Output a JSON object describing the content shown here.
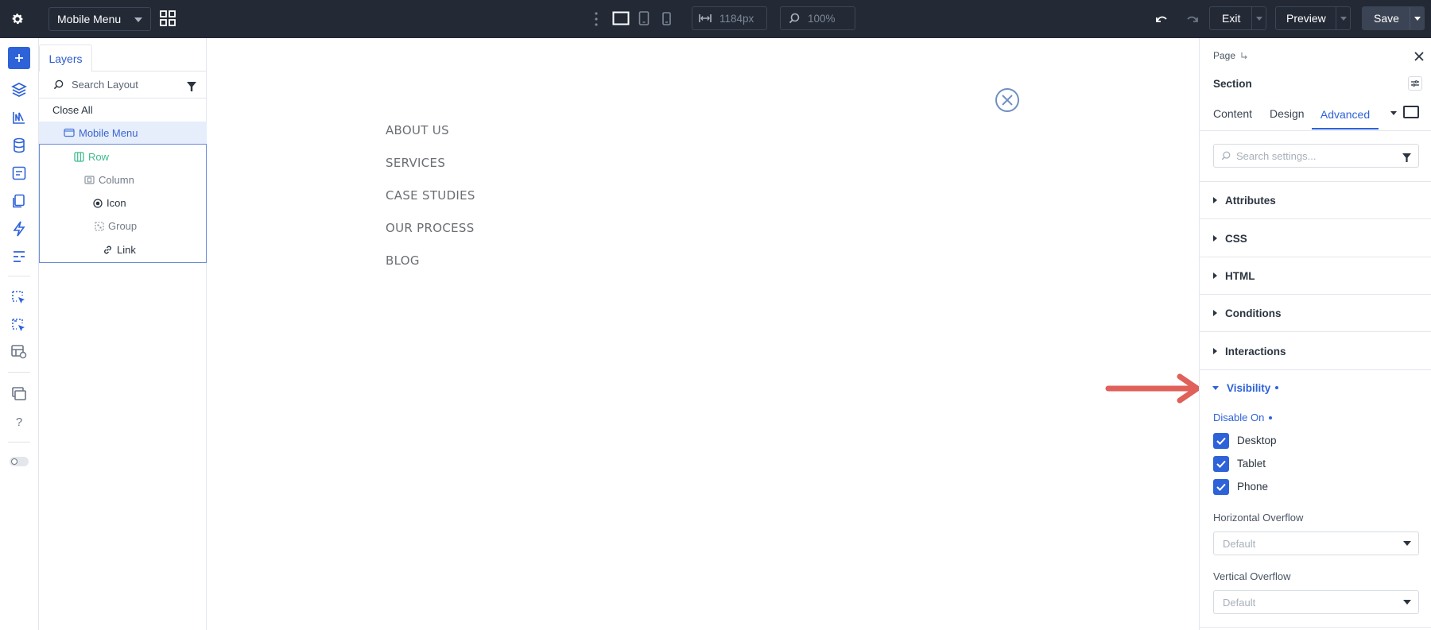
{
  "topbar": {
    "template_select": "Mobile Menu",
    "width_value": "1184px",
    "zoom_value": "100%",
    "exit_label": "Exit",
    "preview_label": "Preview",
    "save_label": "Save"
  },
  "layers": {
    "tab_label": "Layers",
    "search_placeholder": "Search Layout",
    "close_all": "Close All",
    "tree": [
      {
        "label": "Mobile Menu",
        "icon": "section-icon"
      },
      {
        "label": "Row",
        "icon": "row-icon"
      },
      {
        "label": "Column",
        "icon": "column-icon"
      },
      {
        "label": "Icon",
        "icon": "icon-module-icon"
      },
      {
        "label": "Group",
        "icon": "group-icon"
      },
      {
        "label": "Link",
        "icon": "link-icon"
      }
    ]
  },
  "canvas": {
    "menu_items": [
      "ABOUT US",
      "SERVICES",
      "CASE STUDIES",
      "OUR PROCESS",
      "BLOG"
    ]
  },
  "settings": {
    "breadcrumb": "Page",
    "title": "Section",
    "tabs": [
      "Content",
      "Design",
      "Advanced"
    ],
    "active_tab": "Advanced",
    "search_placeholder": "Search settings...",
    "accordions": [
      "Attributes",
      "CSS",
      "HTML",
      "Conditions",
      "Interactions"
    ],
    "visibility": {
      "label": "Visibility",
      "disable_on_label": "Disable On",
      "options": [
        {
          "label": "Desktop",
          "checked": true
        },
        {
          "label": "Tablet",
          "checked": true
        },
        {
          "label": "Phone",
          "checked": true
        }
      ],
      "horizontal_overflow_label": "Horizontal Overflow",
      "horizontal_overflow_value": "Default",
      "vertical_overflow_label": "Vertical Overflow",
      "vertical_overflow_value": "Default"
    }
  },
  "colors": {
    "topbar_bg": "#232a36",
    "accent_blue": "#2e62d9",
    "annotation_arrow": "#e0605a",
    "row_green": "#3dbb8a"
  }
}
